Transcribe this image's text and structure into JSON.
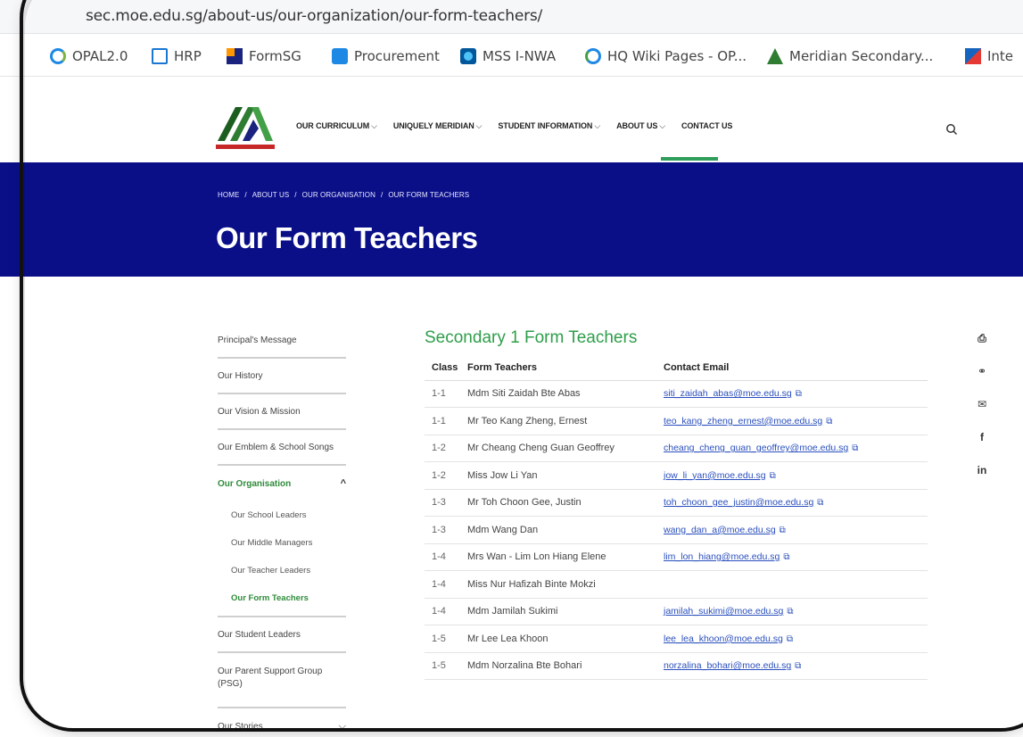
{
  "browser": {
    "url": "sec.moe.edu.sg/about-us/our-organization/our-form-teachers/",
    "bookmarks": [
      {
        "label": "OPAL2.0",
        "icon": "opal-icon"
      },
      {
        "label": "HRP",
        "icon": "hrp-icon"
      },
      {
        "label": "FormSG",
        "icon": "formsg-icon"
      },
      {
        "label": "Procurement",
        "icon": "procurement-icon"
      },
      {
        "label": "MSS I-NWA",
        "icon": "mss-icon"
      },
      {
        "label": "HQ Wiki Pages - OP...",
        "icon": "wiki-icon"
      },
      {
        "label": "Meridian Secondary...",
        "icon": "meridian-icon"
      },
      {
        "label": "Inte",
        "icon": "intranet-icon"
      }
    ]
  },
  "nav": {
    "items": [
      {
        "label": "OUR CURRICULUM",
        "chevron": "⌵"
      },
      {
        "label": "UNIQUELY MERIDIAN",
        "chevron": "⌵"
      },
      {
        "label": "STUDENT INFORMATION",
        "chevron": "⌵"
      },
      {
        "label": "ABOUT US",
        "chevron": "⌵"
      },
      {
        "label": "CONTACT US",
        "chevron": ""
      }
    ],
    "active_color": "#2e9e5a"
  },
  "banner": {
    "breadcrumb": [
      "HOME",
      "ABOUT US",
      "OUR ORGANISATION",
      "OUR FORM TEACHERS"
    ],
    "separator": "/",
    "title": "Our Form Teachers",
    "bg_color": "#0a0f88"
  },
  "sidebar": {
    "items": [
      {
        "label": "Principal's Message"
      },
      {
        "label": "Our History"
      },
      {
        "label": "Our Vision & Mission"
      },
      {
        "label": "Our Emblem & School Songs"
      }
    ],
    "organisation": {
      "label": "Our Organisation",
      "chevron": "^",
      "children": [
        "Our School Leaders",
        "Our Middle Managers",
        "Our Teacher Leaders",
        "Our Form Teachers"
      ]
    },
    "after": [
      {
        "label": "Our Student Leaders"
      },
      {
        "label": "Our Parent Support Group (PSG)"
      },
      {
        "label": "Our Stories",
        "chevron": "⌵"
      }
    ]
  },
  "content": {
    "section_title": "Secondary 1 Form Teachers",
    "columns": [
      "Class",
      "Form Teachers",
      "Contact Email"
    ],
    "rows": [
      {
        "cls": "1-1",
        "name": "Mdm Siti Zaidah Bte Abas",
        "email": "siti_zaidah_abas@moe.edu.sg"
      },
      {
        "cls": "1-1",
        "name": "Mr Teo Kang Zheng, Ernest",
        "email": "teo_kang_zheng_ernest@moe.edu.sg"
      },
      {
        "cls": "1-2",
        "name": "Mr Cheang Cheng Guan Geoffrey",
        "email": "cheang_cheng_guan_geoffrey@moe.edu.sg"
      },
      {
        "cls": "1-2",
        "name": "Miss Jow Li Yan",
        "email": "jow_li_yan@moe.edu.sg"
      },
      {
        "cls": "1-3",
        "name": "Mr Toh Choon Gee, Justin",
        "email": "toh_choon_gee_justin@moe.edu.sg"
      },
      {
        "cls": "1-3",
        "name": "Mdm Wang Dan",
        "email": "wang_dan_a@moe.edu.sg"
      },
      {
        "cls": "1-4",
        "name": "Mrs Wan - Lim Lon Hiang Elene",
        "email": "lim_lon_hiang@moe.edu.sg"
      },
      {
        "cls": "1-4",
        "name": "Miss Nur Hafizah Binte Mokzi",
        "email": ""
      },
      {
        "cls": "1-4",
        "name": "Mdm Jamilah Sukimi",
        "email": "jamilah_sukimi@moe.edu.sg"
      },
      {
        "cls": "1-5",
        "name": "Mr Lee Lea Khoon",
        "email": "lee_lea_khoon@moe.edu.sg"
      },
      {
        "cls": "1-5",
        "name": "Mdm Norzalina Bte Bohari",
        "email": "norzalina_bohari@moe.edu.sg"
      }
    ],
    "ext_icon": "⧉",
    "accent_color": "#2e9e4a",
    "link_color": "#2a4fbd"
  },
  "share": [
    {
      "icon": "print-icon",
      "glyph": "⎙"
    },
    {
      "icon": "link-icon",
      "glyph": "⚭"
    },
    {
      "icon": "mail-icon",
      "glyph": "✉"
    },
    {
      "icon": "facebook-icon",
      "glyph": "f"
    },
    {
      "icon": "linkedin-icon",
      "glyph": "in"
    }
  ]
}
